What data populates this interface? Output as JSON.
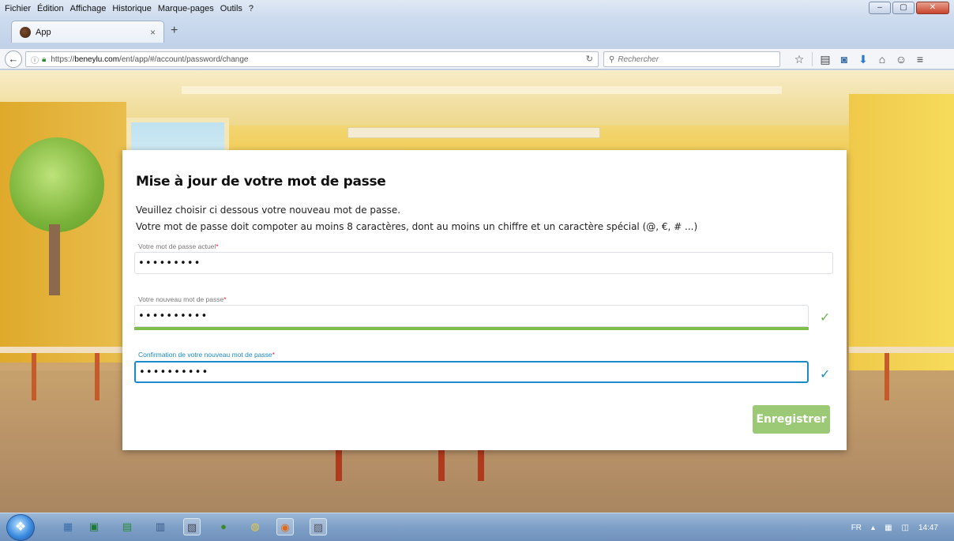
{
  "browser": {
    "menu": [
      {
        "label": "Fichier"
      },
      {
        "label": "Édition"
      },
      {
        "label": "Affichage"
      },
      {
        "label": "Historique"
      },
      {
        "label": "Marque-pages"
      },
      {
        "label": "Outils"
      },
      {
        "label": "?"
      }
    ],
    "tab": {
      "title": "App",
      "close": "×"
    },
    "new_tab": "+",
    "url": {
      "prefix": "https://",
      "domain": "beneylu.com",
      "path": "/ent/app/#/account/password/change"
    },
    "search": {
      "placeholder": "Rechercher"
    }
  },
  "form": {
    "title": "Mise à jour de votre mot de passe",
    "intro": "Veuillez choisir ci dessous votre nouveau mot de passe.",
    "rules": "Votre mot de passe doit compoter au moins 8 caractères, dont au moins un chiffre et un caractère spécial (@, €, # ...)",
    "current_password": {
      "label": "Votre mot de passe actuel",
      "value": "123456789"
    },
    "new_password": {
      "label": "Votre nouveau mot de passe",
      "value": "1234567890",
      "strength": 1.0
    },
    "confirm_password": {
      "label": "Confirmation de votre nouveau mot de passe",
      "value": "1234567890"
    },
    "required_mark": "*",
    "save_label": "Enregistrer"
  },
  "taskbar": {
    "lang": "FR",
    "time": "14:47"
  },
  "colors": {
    "accent": "#1a8ac9",
    "success": "#6ab54a",
    "save_button": "#9cc975",
    "required": "#e22244"
  }
}
